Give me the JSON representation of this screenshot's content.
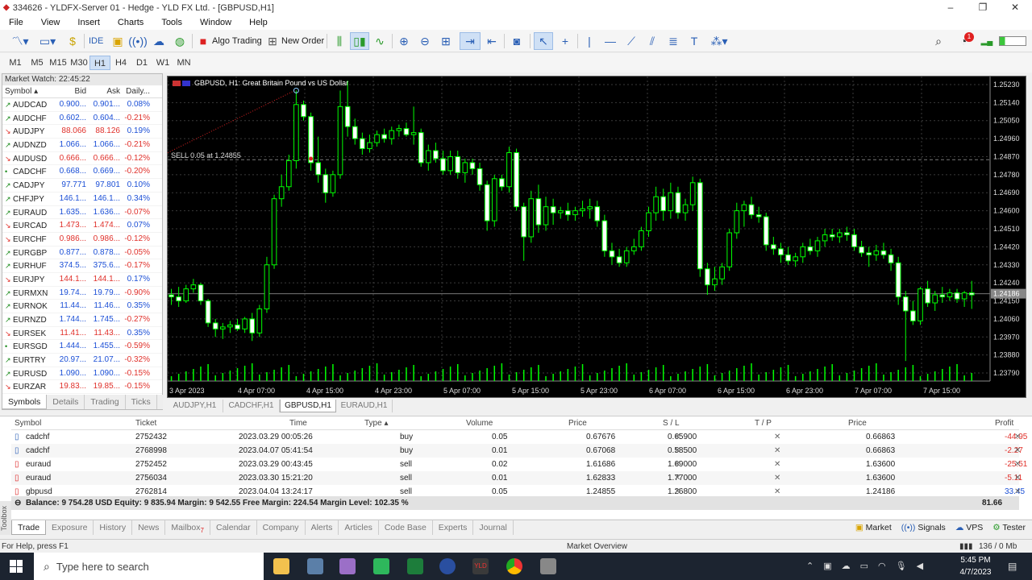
{
  "window": {
    "title": "334626 - YLDFX-Server 01 - Hedge - YLD FX Ltd. - [GBPUSD,H1]"
  },
  "menu": [
    "File",
    "View",
    "Insert",
    "Charts",
    "Tools",
    "Window",
    "Help"
  ],
  "toolbar": {
    "ide_label": "IDE",
    "algo_label": "Algo Trading",
    "new_order_label": "New Order",
    "notification_count": "1"
  },
  "timeframes": [
    "M1",
    "M5",
    "M15",
    "M30",
    "H1",
    "H4",
    "D1",
    "W1",
    "MN"
  ],
  "timeframe_selected": "H1",
  "market_watch": {
    "title": "Market Watch: 22:45:22",
    "headers": [
      "Symbol",
      "Bid",
      "Ask",
      "Daily..."
    ],
    "rows": [
      {
        "s": "AUDCAD",
        "bid": "0.900...",
        "ask": "0.901...",
        "chg": "0.08%",
        "dir": "up"
      },
      {
        "s": "AUDCHF",
        "bid": "0.602...",
        "ask": "0.604...",
        "chg": "-0.21%",
        "dir": "up"
      },
      {
        "s": "AUDJPY",
        "bid": "88.066",
        "ask": "88.126",
        "chg": "0.19%",
        "dir": "dn"
      },
      {
        "s": "AUDNZD",
        "bid": "1.066...",
        "ask": "1.066...",
        "chg": "-0.21%",
        "dir": "up"
      },
      {
        "s": "AUDUSD",
        "bid": "0.666...",
        "ask": "0.666...",
        "chg": "-0.12%",
        "dir": "dn"
      },
      {
        "s": "CADCHF",
        "bid": "0.668...",
        "ask": "0.669...",
        "chg": "-0.20%",
        "dir": "flat"
      },
      {
        "s": "CADJPY",
        "bid": "97.771",
        "ask": "97.801",
        "chg": "0.10%",
        "dir": "up"
      },
      {
        "s": "CHFJPY",
        "bid": "146.1...",
        "ask": "146.1...",
        "chg": "0.34%",
        "dir": "up"
      },
      {
        "s": "EURAUD",
        "bid": "1.635...",
        "ask": "1.636...",
        "chg": "-0.07%",
        "dir": "up"
      },
      {
        "s": "EURCAD",
        "bid": "1.473...",
        "ask": "1.474...",
        "chg": "0.07%",
        "dir": "dn"
      },
      {
        "s": "EURCHF",
        "bid": "0.986...",
        "ask": "0.986...",
        "chg": "-0.12%",
        "dir": "dn"
      },
      {
        "s": "EURGBP",
        "bid": "0.877...",
        "ask": "0.878...",
        "chg": "-0.05%",
        "dir": "up"
      },
      {
        "s": "EURHUF",
        "bid": "374.5...",
        "ask": "375.6...",
        "chg": "-0.17%",
        "dir": "up"
      },
      {
        "s": "EURJPY",
        "bid": "144.1...",
        "ask": "144.1...",
        "chg": "0.17%",
        "dir": "dn"
      },
      {
        "s": "EURMXN",
        "bid": "19.74...",
        "ask": "19.79...",
        "chg": "-0.90%",
        "dir": "up"
      },
      {
        "s": "EURNOK",
        "bid": "11.44...",
        "ask": "11.46...",
        "chg": "0.35%",
        "dir": "up"
      },
      {
        "s": "EURNZD",
        "bid": "1.744...",
        "ask": "1.745...",
        "chg": "-0.27%",
        "dir": "up"
      },
      {
        "s": "EURSEK",
        "bid": "11.41...",
        "ask": "11.43...",
        "chg": "0.35%",
        "dir": "dn"
      },
      {
        "s": "EURSGD",
        "bid": "1.444...",
        "ask": "1.455...",
        "chg": "-0.59%",
        "dir": "flat"
      },
      {
        "s": "EURTRY",
        "bid": "20.97...",
        "ask": "21.07...",
        "chg": "-0.32%",
        "dir": "up"
      },
      {
        "s": "EURUSD",
        "bid": "1.090...",
        "ask": "1.090...",
        "chg": "-0.15%",
        "dir": "up"
      },
      {
        "s": "EURZAR",
        "bid": "19.83...",
        "ask": "19.85...",
        "chg": "-0.15%",
        "dir": "dn"
      }
    ],
    "tabs": [
      "Symbols",
      "Details",
      "Trading",
      "Ticks"
    ]
  },
  "chart_tabs": [
    "AUDJPY,H1",
    "CADCHF,H1",
    "GBPUSD,H1",
    "EURAUD,H1"
  ],
  "chart_tab_selected": "GBPUSD,H1",
  "chart_data": {
    "type": "candlestick",
    "title": "GBPUSD, H1:  Great Britain Pound vs US Dollar",
    "trade_label": "SELL 0.05 at 1.24855",
    "current_price": "1.24186",
    "y_ticks": [
      "1.25230",
      "1.25140",
      "1.25050",
      "1.24960",
      "1.24870",
      "1.24780",
      "1.24690",
      "1.24600",
      "1.24510",
      "1.24420",
      "1.24330",
      "1.24240",
      "1.24150",
      "1.24060",
      "1.23970",
      "1.23880",
      "1.23790"
    ],
    "x_ticks": [
      "3 Apr 2023",
      "4 Apr 07:00",
      "4 Apr 15:00",
      "4 Apr 23:00",
      "5 Apr 07:00",
      "5 Apr 15:00",
      "5 Apr 23:00",
      "6 Apr 07:00",
      "6 Apr 15:00",
      "6 Apr 23:00",
      "7 Apr 07:00",
      "7 Apr 15:00"
    ],
    "ylim": [
      1.2375,
      1.2527
    ],
    "candles": [
      [
        1.2418,
        1.2421,
        1.2413,
        1.2417
      ],
      [
        1.2417,
        1.2422,
        1.2412,
        1.2415
      ],
      [
        1.2415,
        1.2423,
        1.2414,
        1.2421
      ],
      [
        1.2421,
        1.2426,
        1.2419,
        1.2423
      ],
      [
        1.2423,
        1.2424,
        1.2413,
        1.2415
      ],
      [
        1.2415,
        1.2416,
        1.2402,
        1.2404
      ],
      [
        1.2404,
        1.2406,
        1.2397,
        1.2401
      ],
      [
        1.2401,
        1.2404,
        1.2396,
        1.2402
      ],
      [
        1.2402,
        1.2405,
        1.2399,
        1.2403
      ],
      [
        1.2403,
        1.2406,
        1.24,
        1.2401
      ],
      [
        1.2401,
        1.2407,
        1.2399,
        1.2406
      ],
      [
        1.2406,
        1.2409,
        1.2395,
        1.2399
      ],
      [
        1.2399,
        1.2413,
        1.2397,
        1.2411
      ],
      [
        1.2411,
        1.2437,
        1.2409,
        1.2433
      ],
      [
        1.2433,
        1.2468,
        1.2431,
        1.2466
      ],
      [
        1.2466,
        1.2478,
        1.2462,
        1.2472
      ],
      [
        1.2472,
        1.2488,
        1.247,
        1.2485
      ],
      [
        1.2485,
        1.252,
        1.2481,
        1.2513
      ],
      [
        1.2513,
        1.2515,
        1.2505,
        1.2507
      ],
      [
        1.2507,
        1.2509,
        1.248,
        1.2484
      ],
      [
        1.2484,
        1.2497,
        1.2474,
        1.2478
      ],
      [
        1.2478,
        1.2481,
        1.2464,
        1.2469
      ],
      [
        1.2469,
        1.248,
        1.2467,
        1.2478
      ],
      [
        1.2478,
        1.252,
        1.2476,
        1.2512
      ],
      [
        1.2512,
        1.2525,
        1.2497,
        1.2502
      ],
      [
        1.2502,
        1.2506,
        1.2493,
        1.2496
      ],
      [
        1.2496,
        1.2499,
        1.2488,
        1.2491
      ],
      [
        1.2491,
        1.2498,
        1.2489,
        1.2494
      ],
      [
        1.2494,
        1.25,
        1.2492,
        1.2498
      ],
      [
        1.2498,
        1.2501,
        1.2494,
        1.2496
      ],
      [
        1.2496,
        1.2502,
        1.2493,
        1.25
      ],
      [
        1.25,
        1.2503,
        1.2497,
        1.2501
      ],
      [
        1.2501,
        1.2504,
        1.2497,
        1.2498
      ],
      [
        1.2498,
        1.2512,
        1.2493,
        1.2499
      ],
      [
        1.2499,
        1.2501,
        1.2482,
        1.2484
      ],
      [
        1.2484,
        1.2493,
        1.248,
        1.249
      ],
      [
        1.249,
        1.2494,
        1.2484,
        1.2486
      ],
      [
        1.2486,
        1.249,
        1.2478,
        1.248
      ],
      [
        1.248,
        1.249,
        1.2478,
        1.2487
      ],
      [
        1.2487,
        1.249,
        1.2476,
        1.2479
      ],
      [
        1.2479,
        1.2486,
        1.2474,
        1.2484
      ],
      [
        1.2484,
        1.2486,
        1.2478,
        1.2481
      ],
      [
        1.2481,
        1.2484,
        1.247,
        1.2473
      ],
      [
        1.2473,
        1.2475,
        1.245,
        1.2455
      ],
      [
        1.2455,
        1.2478,
        1.2452,
        1.2476
      ],
      [
        1.2476,
        1.2478,
        1.247,
        1.2472
      ],
      [
        1.2472,
        1.2492,
        1.2469,
        1.2489
      ],
      [
        1.2489,
        1.2491,
        1.246,
        1.2462
      ],
      [
        1.2462,
        1.2464,
        1.2435,
        1.2447
      ],
      [
        1.2447,
        1.247,
        1.2444,
        1.2466
      ],
      [
        1.2466,
        1.2473,
        1.2449,
        1.2453
      ],
      [
        1.2453,
        1.2467,
        1.245,
        1.2462
      ],
      [
        1.2462,
        1.2466,
        1.2453,
        1.2459
      ],
      [
        1.2459,
        1.2462,
        1.2456,
        1.246
      ],
      [
        1.246,
        1.2464,
        1.2455,
        1.2458
      ],
      [
        1.2458,
        1.2462,
        1.2455,
        1.246
      ],
      [
        1.246,
        1.2465,
        1.2457,
        1.2461
      ],
      [
        1.2461,
        1.2466,
        1.2456,
        1.2462
      ],
      [
        1.2462,
        1.2465,
        1.2452,
        1.2455
      ],
      [
        1.2455,
        1.2458,
        1.2437,
        1.244
      ],
      [
        1.244,
        1.2444,
        1.2433,
        1.2437
      ],
      [
        1.2437,
        1.2441,
        1.2432,
        1.2434
      ],
      [
        1.2434,
        1.2442,
        1.2432,
        1.244
      ],
      [
        1.244,
        1.2446,
        1.2438,
        1.2442
      ],
      [
        1.2442,
        1.2452,
        1.244,
        1.245
      ],
      [
        1.245,
        1.2462,
        1.2447,
        1.2459
      ],
      [
        1.2459,
        1.2472,
        1.2455,
        1.2467
      ],
      [
        1.2467,
        1.2471,
        1.2455,
        1.246
      ],
      [
        1.246,
        1.2474,
        1.2456,
        1.2469
      ],
      [
        1.2469,
        1.2472,
        1.2456,
        1.2459
      ],
      [
        1.2459,
        1.2466,
        1.2455,
        1.2463
      ],
      [
        1.2463,
        1.2477,
        1.246,
        1.2474
      ],
      [
        1.2474,
        1.2476,
        1.2427,
        1.2431
      ],
      [
        1.2431,
        1.2434,
        1.2418,
        1.2423
      ],
      [
        1.2423,
        1.2432,
        1.242,
        1.2426
      ],
      [
        1.2426,
        1.2434,
        1.2423,
        1.2432
      ],
      [
        1.2432,
        1.2451,
        1.243,
        1.2449
      ],
      [
        1.2449,
        1.2464,
        1.2446,
        1.246
      ],
      [
        1.246,
        1.2465,
        1.2452,
        1.2463
      ],
      [
        1.2463,
        1.2467,
        1.2456,
        1.2458
      ],
      [
        1.2458,
        1.2462,
        1.2454,
        1.2457
      ],
      [
        1.2457,
        1.2459,
        1.244,
        1.2443
      ],
      [
        1.2443,
        1.2447,
        1.2438,
        1.2441
      ],
      [
        1.2441,
        1.2444,
        1.2434,
        1.2438
      ],
      [
        1.2438,
        1.2442,
        1.2433,
        1.2435
      ],
      [
        1.2435,
        1.2439,
        1.2432,
        1.2437
      ],
      [
        1.2437,
        1.2444,
        1.2434,
        1.2442
      ],
      [
        1.2442,
        1.2446,
        1.2438,
        1.244
      ],
      [
        1.244,
        1.2447,
        1.2437,
        1.2445
      ],
      [
        1.2445,
        1.2451,
        1.2442,
        1.2448
      ],
      [
        1.2448,
        1.2451,
        1.2445,
        1.2447
      ],
      [
        1.2447,
        1.2451,
        1.2444,
        1.2449
      ],
      [
        1.2449,
        1.2452,
        1.2445,
        1.2448
      ],
      [
        1.2448,
        1.2451,
        1.244,
        1.2442
      ],
      [
        1.2442,
        1.2445,
        1.2437,
        1.2439
      ],
      [
        1.2439,
        1.2442,
        1.2432,
        1.2438
      ],
      [
        1.2438,
        1.2443,
        1.2435,
        1.244
      ],
      [
        1.244,
        1.2444,
        1.2436,
        1.2438
      ],
      [
        1.2438,
        1.2441,
        1.243,
        1.2434
      ],
      [
        1.2434,
        1.2437,
        1.2413,
        1.2417
      ],
      [
        1.2417,
        1.242,
        1.2385,
        1.241
      ],
      [
        1.241,
        1.2415,
        1.2403,
        1.2405
      ],
      [
        1.2405,
        1.2422,
        1.2403,
        1.2421
      ],
      [
        1.2421,
        1.2425,
        1.2412,
        1.2414
      ],
      [
        1.2414,
        1.242,
        1.241,
        1.2418
      ],
      [
        1.2418,
        1.2422,
        1.2414,
        1.2417
      ],
      [
        1.2417,
        1.2421,
        1.2415,
        1.2419
      ],
      [
        1.2419,
        1.2421,
        1.2414,
        1.2416
      ],
      [
        1.2416,
        1.242,
        1.2412,
        1.2419
      ],
      [
        1.2419,
        1.2425,
        1.2411,
        1.2418
      ]
    ]
  },
  "trade_table": {
    "headers": [
      "Symbol",
      "Ticket",
      "Time",
      "Type",
      "Volume",
      "Price",
      "S / L",
      "T / P",
      "Price",
      "Profit"
    ],
    "rows": [
      {
        "symbol": "cadchf",
        "ticket": "2752432",
        "time": "2023.03.29 00:05:26",
        "type": "buy",
        "volume": "0.05",
        "price": "0.67676",
        "sl": "0.65900",
        "tp": "",
        "cur": "0.66863",
        "profit": "-44.95"
      },
      {
        "symbol": "cadchf",
        "ticket": "2768998",
        "time": "2023.04.07 05:41:54",
        "type": "buy",
        "volume": "0.01",
        "price": "0.67068",
        "sl": "0.58500",
        "tp": "",
        "cur": "0.66863",
        "profit": "-2.27"
      },
      {
        "symbol": "euraud",
        "ticket": "2752452",
        "time": "2023.03.29 00:43:45",
        "type": "sell",
        "volume": "0.02",
        "price": "1.61686",
        "sl": "1.69000",
        "tp": "",
        "cur": "1.63600",
        "profit": "-25.51"
      },
      {
        "symbol": "euraud",
        "ticket": "2756034",
        "time": "2023.03.30 15:21:20",
        "type": "sell",
        "volume": "0.01",
        "price": "1.62833",
        "sl": "1.77000",
        "tp": "",
        "cur": "1.63600",
        "profit": "-5.11"
      },
      {
        "symbol": "gbpusd",
        "ticket": "2762814",
        "time": "2023.04.04 13:24:17",
        "type": "sell",
        "volume": "0.05",
        "price": "1.24855",
        "sl": "1.26800",
        "tp": "",
        "cur": "1.24186",
        "profit": "33.45"
      }
    ],
    "balance_line": "Balance: 9 754.28 USD  Equity: 9 835.94  Margin: 9 542.55  Free Margin: 224.54  Margin Level: 102.35 %",
    "total_profit": "81.66"
  },
  "toolbox_label": "Toolbox",
  "bottom_tabs": [
    "Trade",
    "Exposure",
    "History",
    "News",
    "Mailbox",
    "Calendar",
    "Company",
    "Alerts",
    "Articles",
    "Code Base",
    "Experts",
    "Journal"
  ],
  "mailbox_count": "7",
  "bottom_right": [
    "Market",
    "Signals",
    "VPS",
    "Tester"
  ],
  "status": {
    "left": "For Help, press F1",
    "mid": "Market Overview",
    "right": "136 / 0 Mb"
  },
  "taskbar": {
    "search_placeholder": "Type here to search",
    "time": "5:45 PM",
    "date": "4/7/2023"
  },
  "colors": {
    "bull": "#00ff00",
    "bear": "#ffffff",
    "chart_bg": "#000000",
    "grid": "#3a3a3a",
    "up": "#1b4fd6",
    "down": "#e0302a",
    "selected": "#cfe0f5"
  }
}
